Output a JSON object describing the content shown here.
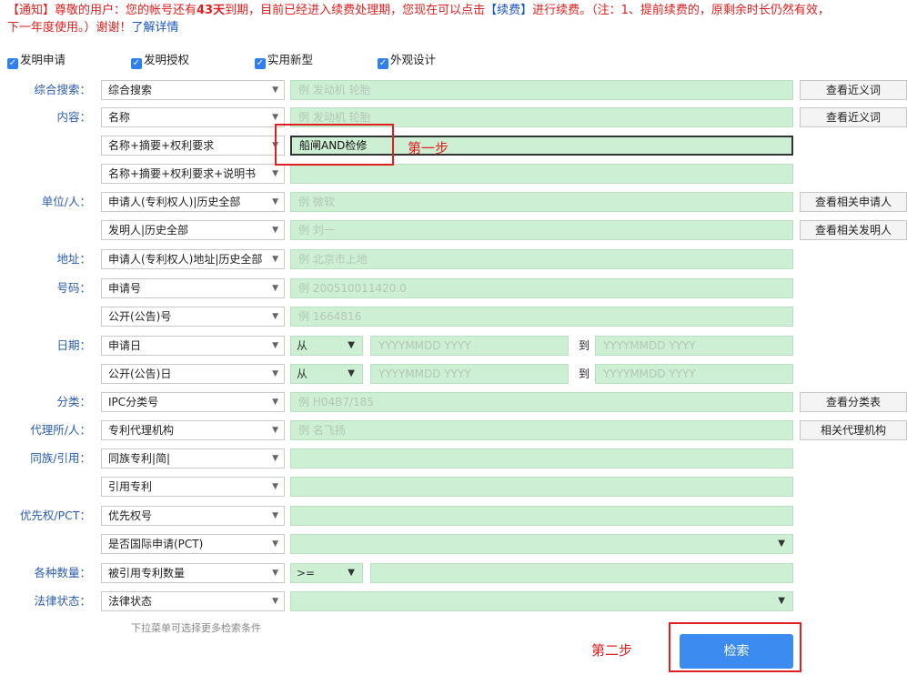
{
  "notice": {
    "p1": "【通知】尊敬的用户：您的帐号还有",
    "days": "43天",
    "p2": "到期，目前已经进入续费处理期，您现在可以点击",
    "renew": "【续费】",
    "p3": "进行续费。（注：1、提前续费的，原剩余时长仍然有效，",
    "p4": "下一年度使用。）谢谢！",
    "more": "了解详情"
  },
  "patent_types": [
    {
      "label": "发明申请",
      "checked": true
    },
    {
      "label": "发明授权",
      "checked": true
    },
    {
      "label": "实用新型",
      "checked": true
    },
    {
      "label": "外观设计",
      "checked": true
    }
  ],
  "labels": {
    "general": "综合搜索：",
    "content": "内容：",
    "org": "单位/人：",
    "address": "地址：",
    "number": "号码：",
    "date": "日期：",
    "classify": "分类：",
    "agency": "代理所/人：",
    "family": "同族/引用：",
    "priority": "优先权/PCT：",
    "counts": "各种数量：",
    "legal": "法律状态："
  },
  "fields": {
    "general": {
      "select": "综合搜索",
      "placeholder": "例 发动机 轮胎"
    },
    "content1": {
      "select": "名称",
      "placeholder": "例 发动机 轮胎"
    },
    "content2": {
      "select": "名称+摘要+权利要求",
      "value": "船闸AND检修"
    },
    "content3": {
      "select": "名称+摘要+权利要求+说明书",
      "value": ""
    },
    "applicant": {
      "select": "申请人(专利权人)|历史全部",
      "placeholder": "例 微软"
    },
    "inventor": {
      "select": "发明人|历史全部",
      "placeholder": "例 刘一"
    },
    "address": {
      "select": "申请人(专利权人)地址|历史全部",
      "placeholder": "例 北京市上地"
    },
    "app_no": {
      "select": "申请号",
      "placeholder": "例 200510011420.0"
    },
    "pub_no": {
      "select": "公开(公告)号",
      "placeholder": "例 1664816"
    },
    "app_date": {
      "select": "申请日",
      "from": "从",
      "start_placeholder": "YYYYMMDD YYYY",
      "to": "到",
      "end_placeholder": "YYYYMMDD YYYY"
    },
    "pub_date": {
      "select": "公开(公告)日",
      "from": "从",
      "start_placeholder": "YYYYMMDD YYYY",
      "to": "到",
      "end_placeholder": "YYYYMMDD YYYY"
    },
    "ipc": {
      "select": "IPC分类号",
      "placeholder": "例 H04B7/185"
    },
    "agency": {
      "select": "专利代理机构",
      "placeholder": "例 名飞扬"
    },
    "family": {
      "select": "同族专利|简|",
      "value": ""
    },
    "cited": {
      "select": "引用专利",
      "value": ""
    },
    "priority_no": {
      "select": "优先权号",
      "value": ""
    },
    "pct": {
      "select": "是否国际申请(PCT)",
      "value": ""
    },
    "cited_count": {
      "select": "被引用专利数量",
      "operator": ">=",
      "value": ""
    },
    "legal_status": {
      "select": "法律状态",
      "value": ""
    }
  },
  "buttons": {
    "synonym1": "查看近义词",
    "synonym2": "查看近义词",
    "applicant": "查看相关申请人",
    "inventor": "查看相关发明人",
    "class_table": "查看分类表",
    "agency": "相关代理机构",
    "search": "检索"
  },
  "annotations": {
    "step1": "第一步",
    "step2": "第二步",
    "accent": "#e02020"
  },
  "hint": "下拉菜单可选择更多检索条件",
  "icons": {
    "dropdown": "chevron-down-icon",
    "checkbox": "check-icon"
  }
}
